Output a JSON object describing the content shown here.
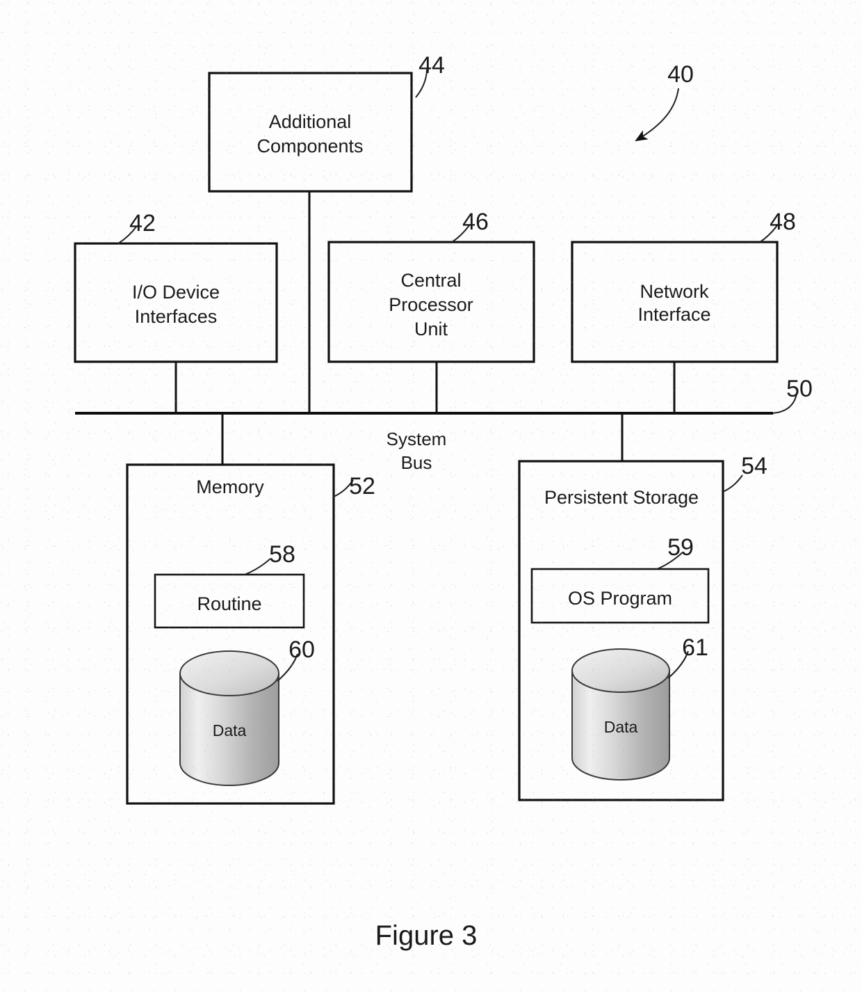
{
  "figure": {
    "caption": "Figure 3",
    "system_ref": "40"
  },
  "bus": {
    "label_line1": "System",
    "label_line2": "Bus",
    "ref": "50"
  },
  "boxes": {
    "additional_components": {
      "line1": "Additional",
      "line2": "Components",
      "ref": "44"
    },
    "io_device_interfaces": {
      "line1": "I/O Device",
      "line2": "Interfaces",
      "ref": "42"
    },
    "central_processor_unit": {
      "line1": "Central",
      "line2": "Processor",
      "line3": "Unit",
      "ref": "46"
    },
    "network_interface": {
      "line1": "Network",
      "line2": "Interface",
      "ref": "48"
    },
    "memory": {
      "title": "Memory",
      "ref": "52",
      "routine": {
        "label": "Routine",
        "ref": "58"
      },
      "data": {
        "label": "Data",
        "ref": "60"
      }
    },
    "persistent_storage": {
      "title": "Persistent Storage",
      "ref": "54",
      "os_program": {
        "label": "OS Program",
        "ref": "59"
      },
      "data": {
        "label": "Data",
        "ref": "61"
      }
    }
  },
  "colors": {
    "ink": "#111111",
    "paper": "#fdfdfd",
    "cylinder_light": "#e8e8e8",
    "cylinder_mid": "#c9c9c9",
    "cylinder_dark": "#a6a6a6"
  }
}
